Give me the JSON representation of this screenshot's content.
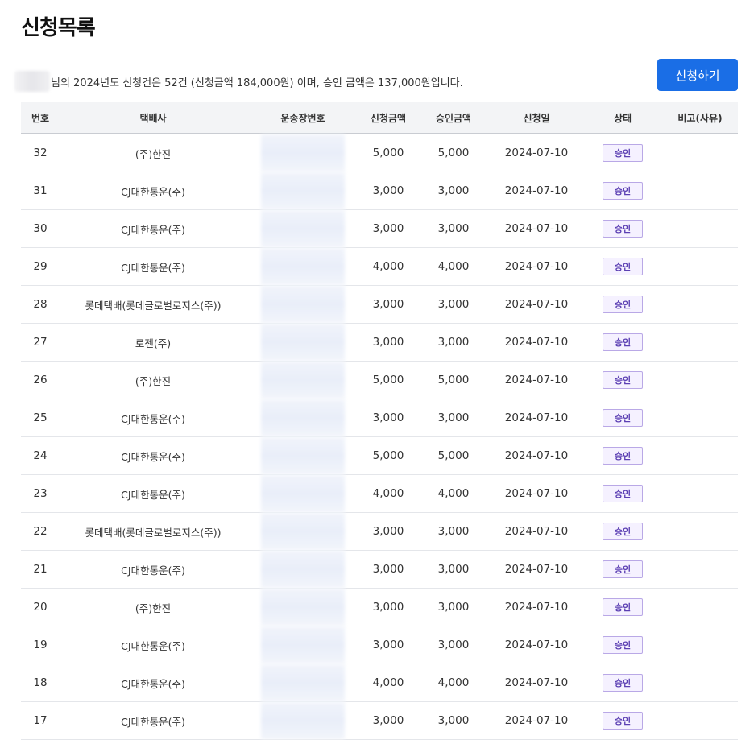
{
  "page": {
    "title": "신청목록",
    "summary": "님의 2024년도 신청건은 52건 (신청금액 184,000원) 이며, 승인 금액은 137,000원입니다.",
    "apply_button": "신청하기"
  },
  "table": {
    "headers": {
      "no": "번호",
      "courier": "택배사",
      "tracking": "운송장번호",
      "request_amount": "신청금액",
      "approved_amount": "승인금액",
      "date": "신청일",
      "status": "상태",
      "note": "비고(사유)"
    },
    "rows": [
      {
        "no": "32",
        "courier": "(주)한진",
        "request": "5,000",
        "approved": "5,000",
        "date": "2024-07-10",
        "status": "승인"
      },
      {
        "no": "31",
        "courier": "CJ대한통운(주)",
        "request": "3,000",
        "approved": "3,000",
        "date": "2024-07-10",
        "status": "승인"
      },
      {
        "no": "30",
        "courier": "CJ대한통운(주)",
        "request": "3,000",
        "approved": "3,000",
        "date": "2024-07-10",
        "status": "승인"
      },
      {
        "no": "29",
        "courier": "CJ대한통운(주)",
        "request": "4,000",
        "approved": "4,000",
        "date": "2024-07-10",
        "status": "승인"
      },
      {
        "no": "28",
        "courier": "롯데택배(롯데글로벌로지스(주))",
        "request": "3,000",
        "approved": "3,000",
        "date": "2024-07-10",
        "status": "승인"
      },
      {
        "no": "27",
        "courier": "로젠(주)",
        "request": "3,000",
        "approved": "3,000",
        "date": "2024-07-10",
        "status": "승인"
      },
      {
        "no": "26",
        "courier": "(주)한진",
        "request": "5,000",
        "approved": "5,000",
        "date": "2024-07-10",
        "status": "승인"
      },
      {
        "no": "25",
        "courier": "CJ대한통운(주)",
        "request": "3,000",
        "approved": "3,000",
        "date": "2024-07-10",
        "status": "승인"
      },
      {
        "no": "24",
        "courier": "CJ대한통운(주)",
        "request": "5,000",
        "approved": "5,000",
        "date": "2024-07-10",
        "status": "승인"
      },
      {
        "no": "23",
        "courier": "CJ대한통운(주)",
        "request": "4,000",
        "approved": "4,000",
        "date": "2024-07-10",
        "status": "승인"
      },
      {
        "no": "22",
        "courier": "롯데택배(롯데글로벌로지스(주))",
        "request": "3,000",
        "approved": "3,000",
        "date": "2024-07-10",
        "status": "승인"
      },
      {
        "no": "21",
        "courier": "CJ대한통운(주)",
        "request": "3,000",
        "approved": "3,000",
        "date": "2024-07-10",
        "status": "승인"
      },
      {
        "no": "20",
        "courier": "(주)한진",
        "request": "3,000",
        "approved": "3,000",
        "date": "2024-07-10",
        "status": "승인"
      },
      {
        "no": "19",
        "courier": "CJ대한통운(주)",
        "request": "3,000",
        "approved": "3,000",
        "date": "2024-07-10",
        "status": "승인"
      },
      {
        "no": "18",
        "courier": "CJ대한통운(주)",
        "request": "4,000",
        "approved": "4,000",
        "date": "2024-07-10",
        "status": "승인"
      },
      {
        "no": "17",
        "courier": "CJ대한통운(주)",
        "request": "3,000",
        "approved": "3,000",
        "date": "2024-07-10",
        "status": "승인"
      }
    ]
  },
  "colors": {
    "accent": "#1a6ee6",
    "status_badge_border": "#b9a8e6",
    "status_badge_text": "#5b3fb3"
  }
}
